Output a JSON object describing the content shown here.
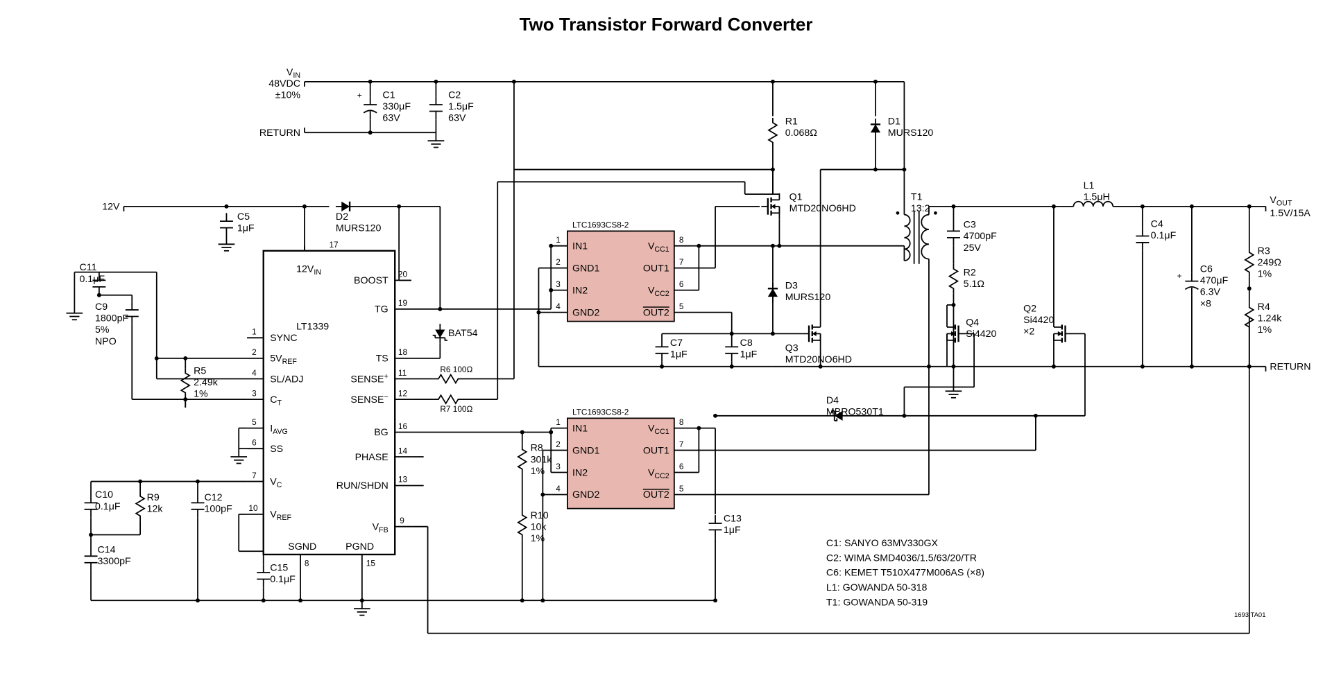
{
  "title": "Two Transistor Forward Converter",
  "inputs": {
    "vin_label": "V",
    "vin_sub": "IN",
    "vin_val": "48VDC",
    "vin_tol": "±10%",
    "return1": "RETURN",
    "v12": "12V"
  },
  "outputs": {
    "vout_label": "V",
    "vout_sub": "OUT",
    "vout_val": "1.5V/15A",
    "return2": "RETURN"
  },
  "main_ic": {
    "name": "LT1339",
    "rail": "12V",
    "rail_sub": "IN",
    "pins_left": [
      {
        "num": "1",
        "lbl": "SYNC"
      },
      {
        "num": "2",
        "lbl": "5V",
        "sub": "REF"
      },
      {
        "num": "4",
        "lbl": "SL/ADJ"
      },
      {
        "num": "3",
        "lbl": "C",
        "sub": "T"
      },
      {
        "num": "5",
        "lbl": "I",
        "sub": "AVG"
      },
      {
        "num": "6",
        "lbl": "SS"
      },
      {
        "num": "7",
        "lbl": "V",
        "sub": "C"
      },
      {
        "num": "10",
        "lbl": "V",
        "sub": "REF"
      }
    ],
    "pins_right": [
      {
        "num": "17",
        "lbl": ""
      },
      {
        "num": "20",
        "lbl": "BOOST"
      },
      {
        "num": "19",
        "lbl": "TG"
      },
      {
        "num": "18",
        "lbl": "TS"
      },
      {
        "num": "11",
        "lbl": "SENSE",
        "sup": "+"
      },
      {
        "num": "12",
        "lbl": "SENSE",
        "sup": "−"
      },
      {
        "num": "16",
        "lbl": "BG"
      },
      {
        "num": "14",
        "lbl": "PHASE"
      },
      {
        "num": "13",
        "lbl": "RUN/SHDN"
      },
      {
        "num": "9",
        "lbl": "V",
        "sub": "FB"
      }
    ],
    "sgnd": "SGND",
    "pgnd": "PGND",
    "sgnd_pin": "8",
    "pgnd_pin": "15"
  },
  "driver1": {
    "name": "LTC1693CS8-2",
    "pins": [
      {
        "num": "1",
        "lbl": "IN1"
      },
      {
        "num": "2",
        "lbl": "GND1"
      },
      {
        "num": "3",
        "lbl": "IN2"
      },
      {
        "num": "4",
        "lbl": "GND2"
      },
      {
        "num": "8",
        "lbl": "V",
        "sub": "CC1"
      },
      {
        "num": "7",
        "lbl": "OUT1"
      },
      {
        "num": "6",
        "lbl": "V",
        "sub": "CC2"
      },
      {
        "num": "5",
        "lbl": "OUT2",
        "bar": true
      }
    ]
  },
  "driver2": {
    "name": "LTC1693CS8-2",
    "pins": [
      {
        "num": "1",
        "lbl": "IN1"
      },
      {
        "num": "2",
        "lbl": "GND1"
      },
      {
        "num": "3",
        "lbl": "IN2"
      },
      {
        "num": "4",
        "lbl": "GND2"
      },
      {
        "num": "8",
        "lbl": "V",
        "sub": "CC1"
      },
      {
        "num": "7",
        "lbl": "OUT1"
      },
      {
        "num": "6",
        "lbl": "V",
        "sub": "CC2"
      },
      {
        "num": "5",
        "lbl": "OUT2",
        "bar": true
      }
    ]
  },
  "components": {
    "C1": {
      "ref": "C1",
      "val": "330μF",
      "v": "63V"
    },
    "C2": {
      "ref": "C2",
      "val": "1.5μF",
      "v": "63V"
    },
    "C3": {
      "ref": "C3",
      "val": "4700pF",
      "v": "25V"
    },
    "C4": {
      "ref": "C4",
      "val": "0.1μF"
    },
    "C5": {
      "ref": "C5",
      "val": "1μF"
    },
    "C6": {
      "ref": "C6",
      "val": "470μF",
      "v": "6.3V",
      "mult": "×8"
    },
    "C7": {
      "ref": "C7",
      "val": "1μF"
    },
    "C8": {
      "ref": "C8",
      "val": "1μF"
    },
    "C9": {
      "ref": "C9",
      "val": "1800pF",
      "tol": "5%",
      "type": "NPO"
    },
    "C10": {
      "ref": "C10",
      "val": "0.1μF"
    },
    "C11": {
      "ref": "C11",
      "val": "0.1μF"
    },
    "C12": {
      "ref": "C12",
      "val": "100pF"
    },
    "C13": {
      "ref": "C13",
      "val": "1μF"
    },
    "C14": {
      "ref": "C14",
      "val": "3300pF"
    },
    "C15": {
      "ref": "C15",
      "val": "0.1μF"
    },
    "R1": {
      "ref": "R1",
      "val": "0.068Ω"
    },
    "R2": {
      "ref": "R2",
      "val": "5.1Ω"
    },
    "R3": {
      "ref": "R3",
      "val": "249Ω",
      "tol": "1%"
    },
    "R4": {
      "ref": "R4",
      "val": "1.24k",
      "tol": "1%"
    },
    "R5": {
      "ref": "R5",
      "val": "2.49k",
      "tol": "1%"
    },
    "R6": {
      "ref": "R6",
      "val": "100Ω"
    },
    "R7": {
      "ref": "R7",
      "val": "100Ω"
    },
    "R8": {
      "ref": "R8",
      "val": "301k",
      "tol": "1%"
    },
    "R9": {
      "ref": "R9",
      "val": "12k"
    },
    "R10": {
      "ref": "R10",
      "val": "10k",
      "tol": "1%"
    },
    "D1": {
      "ref": "D1",
      "val": "MURS120"
    },
    "D2": {
      "ref": "D2",
      "val": "MURS120"
    },
    "D3": {
      "ref": "D3",
      "val": "MURS120"
    },
    "D4": {
      "ref": "D4",
      "val": "MBRO530T1"
    },
    "D5": {
      "ref": "BAT54"
    },
    "Q1": {
      "ref": "Q1",
      "val": "MTD20NO6HD"
    },
    "Q2": {
      "ref": "Q2",
      "val": "Si4420",
      "mult": "×2"
    },
    "Q3": {
      "ref": "Q3",
      "val": "MTD20NO6HD"
    },
    "Q4": {
      "ref": "Q4",
      "val": "Si4420"
    },
    "L1": {
      "ref": "L1",
      "val": "1.5μH"
    },
    "T1": {
      "ref": "T1",
      "val": "13:2"
    }
  },
  "bom": {
    "l1": "C1: SANYO 63MV330GX",
    "l2": "C2: WIMA SMD4036/1.5/63/20/TR",
    "l3": "C6: KEMET T510X477M006AS (×8)",
    "l4": "L1: GOWANDA 50-318",
    "l5": "T1: GOWANDA 50-319"
  },
  "drawing_id": "1693 TA01"
}
